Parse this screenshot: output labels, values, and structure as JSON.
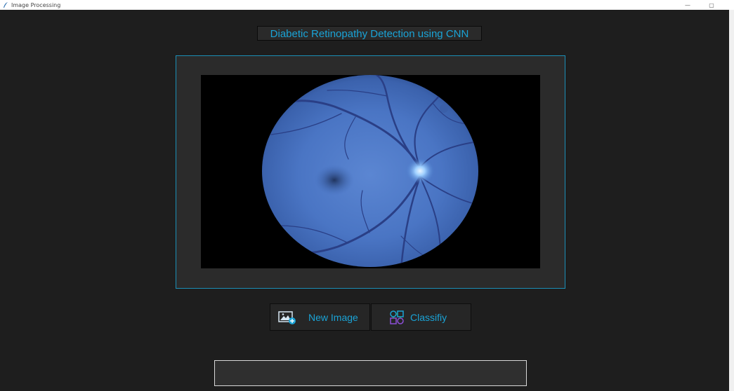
{
  "window": {
    "title": "Image Processing",
    "minimize_symbol": "—",
    "maximize_symbol": "▢"
  },
  "heading": "Diabetic Retinopathy Detection using CNN",
  "image": {
    "icon": "retina-fundus-image"
  },
  "buttons": {
    "new_image_label": "New Image",
    "new_image_icon": "add-image-icon",
    "classify_label": "Classifiy",
    "classify_icon": "classify-icon"
  },
  "result": {
    "text": ""
  },
  "colors": {
    "accent": "#1aa3d6",
    "background": "#1e1e1e",
    "frame_border": "#1b8fb7"
  }
}
